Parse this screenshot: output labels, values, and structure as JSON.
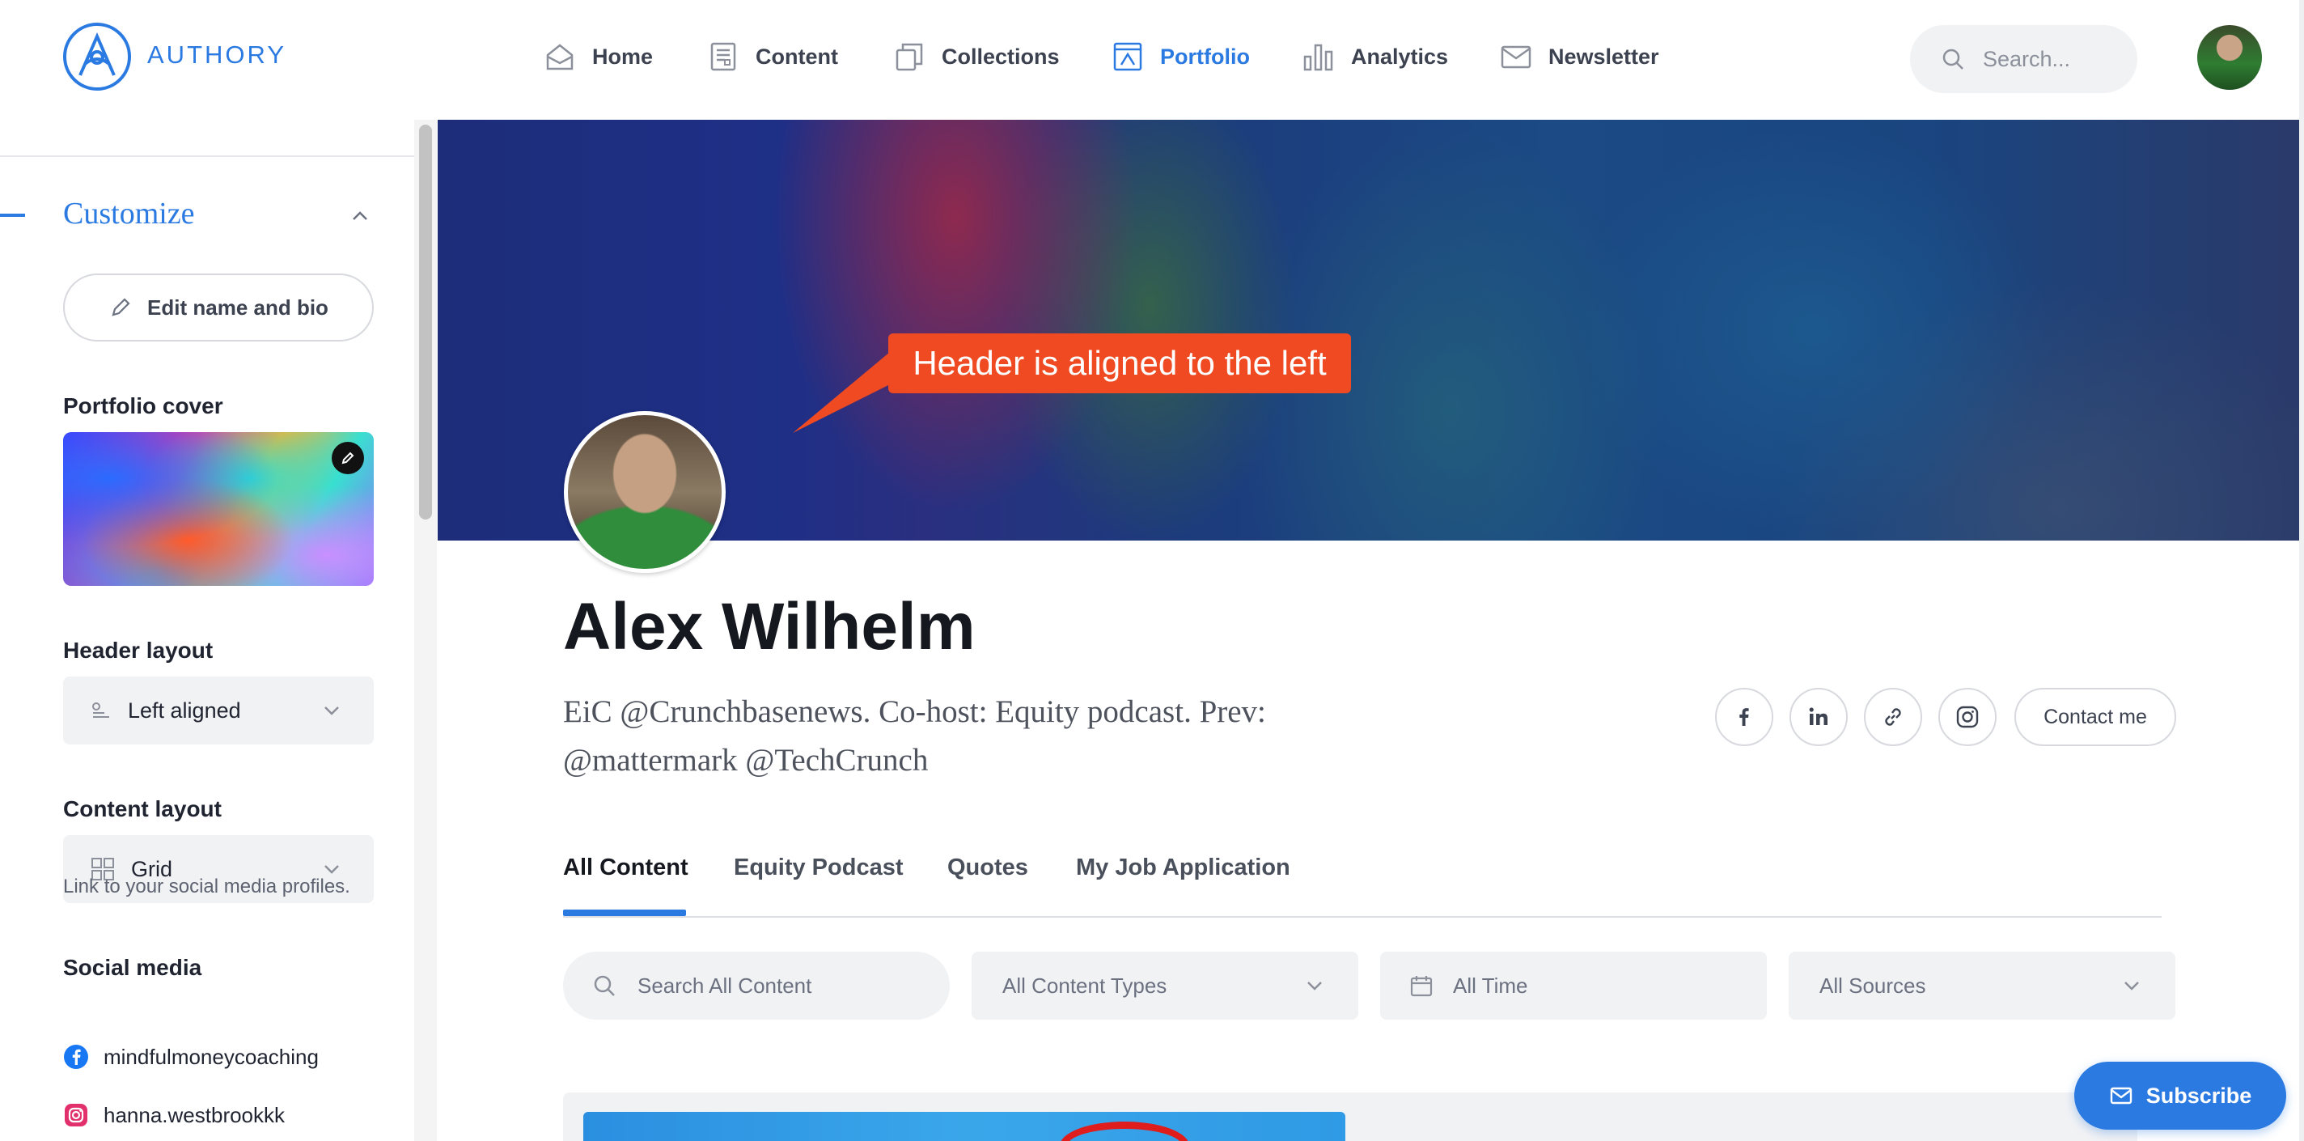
{
  "brand": {
    "name": "AUTHORY",
    "accent": "#2a7ae2"
  },
  "nav": {
    "items": [
      {
        "label": "Home",
        "icon": "home-icon"
      },
      {
        "label": "Content",
        "icon": "content-icon"
      },
      {
        "label": "Collections",
        "icon": "collections-icon"
      },
      {
        "label": "Portfolio",
        "icon": "portfolio-icon",
        "active": true
      },
      {
        "label": "Analytics",
        "icon": "analytics-icon"
      },
      {
        "label": "Newsletter",
        "icon": "newsletter-icon"
      }
    ],
    "search_placeholder": "Search..."
  },
  "sidebar": {
    "title": "Customize",
    "edit_label": "Edit name and bio",
    "cover_label": "Portfolio cover",
    "header_layout": {
      "label": "Header layout",
      "value": "Left aligned"
    },
    "content_layout": {
      "label": "Content layout",
      "value": "Grid"
    },
    "social": {
      "label": "Social media",
      "description": "Link to your social media profiles.",
      "accounts": [
        {
          "network": "facebook",
          "handle": "mindfulmoneycoaching"
        },
        {
          "network": "instagram",
          "handle": "hanna.westbrookkk"
        }
      ]
    }
  },
  "annotation": {
    "text": "Header is aligned to the left",
    "color": "#ef4a22"
  },
  "profile": {
    "name": "Alex Wilhelm",
    "bio": "EiC @Crunchbasenews. Co-host: Equity podcast. Prev: @mattermark @TechCrunch",
    "contact_label": "Contact me",
    "social_icons": [
      "facebook-icon",
      "linkedin-icon",
      "link-icon",
      "instagram-icon"
    ]
  },
  "tabs": [
    {
      "label": "All Content",
      "active": true
    },
    {
      "label": "Equity Podcast"
    },
    {
      "label": "Quotes"
    },
    {
      "label": "My Job Application"
    }
  ],
  "filters": {
    "search_placeholder": "Search All Content",
    "content_types": "All Content Types",
    "time": "All Time",
    "sources": "All Sources"
  },
  "subscribe_label": "Subscribe"
}
